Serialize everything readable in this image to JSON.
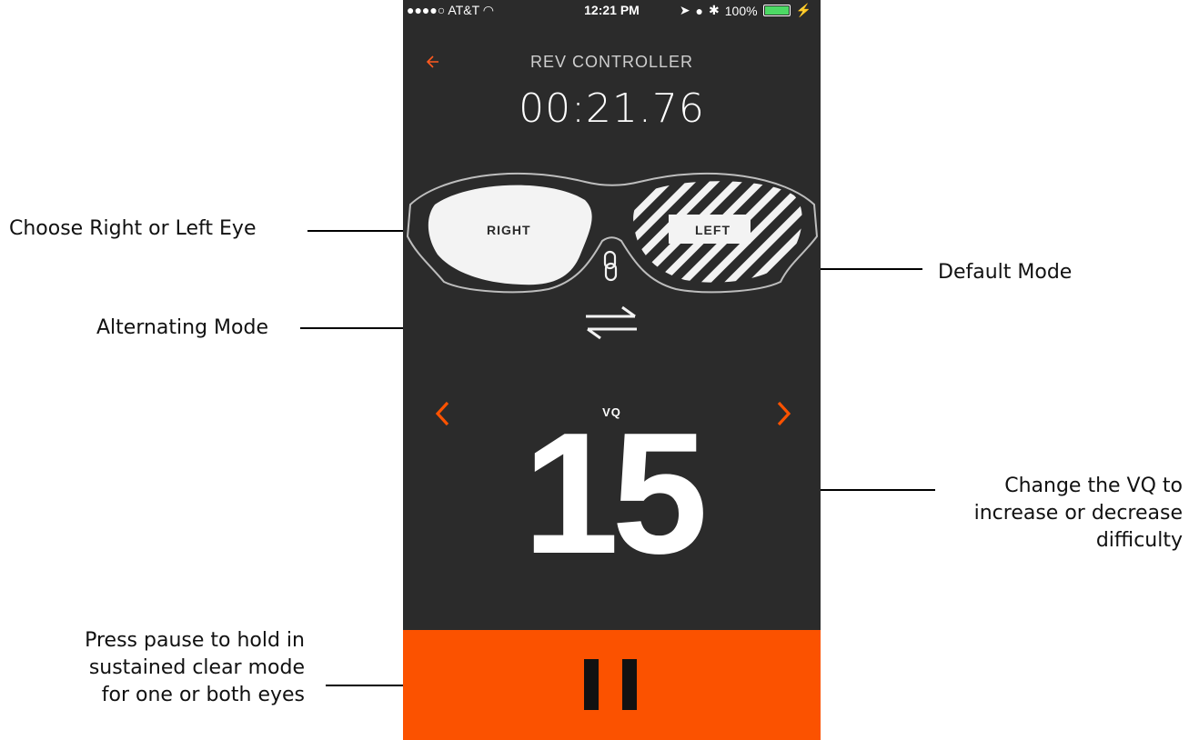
{
  "status_bar": {
    "carrier": "●●●●○ AT&T",
    "time": "12:21 PM",
    "battery": "100%",
    "icons": [
      "wifi-icon",
      "location-icon",
      "alarm-icon",
      "bluetooth-icon",
      "battery-icon",
      "charging-icon"
    ]
  },
  "nav": {
    "title": "REV CONTROLLER",
    "back_icon": "back-arrow-icon"
  },
  "timer": "00:21.76",
  "eyes": {
    "right_label": "RIGHT",
    "left_label": "LEFT",
    "right_state": "clear",
    "left_state": "striped"
  },
  "modes": {
    "default_icon": "link-icon",
    "alternating_icon": "swap-arrows-icon"
  },
  "vq": {
    "label": "VQ",
    "value": "15"
  },
  "controls": {
    "pause_icon": "pause-icon",
    "decrease_icon": "chevron-left-icon",
    "increase_icon": "chevron-right-icon"
  },
  "colors": {
    "accent": "#fb5200",
    "background": "#2b2b2b",
    "text": "#ffffff"
  },
  "annotations": {
    "eye_choice": "Choose Right or Left Eye",
    "default_mode": "Default Mode",
    "alternating_mode": "Alternating Mode",
    "vq_line1": "Change the VQ to",
    "vq_line2": "increase or decrease",
    "vq_line3": "difficulty",
    "pause_line1": "Press pause to hold in",
    "pause_line2": "sustained clear mode",
    "pause_line3": "for one or both eyes"
  }
}
